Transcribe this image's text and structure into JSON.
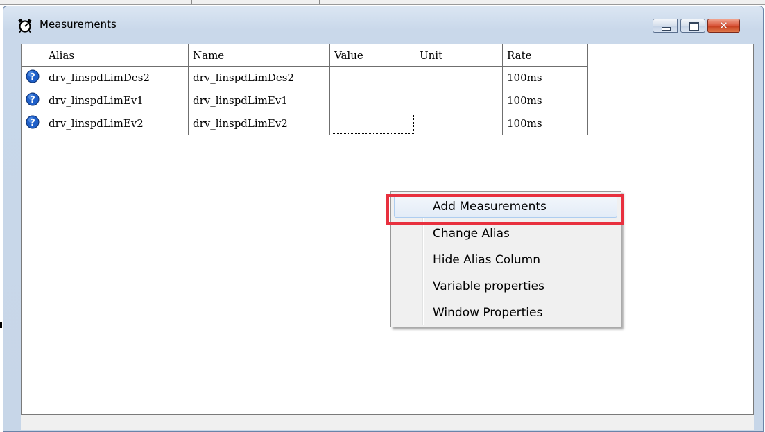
{
  "window": {
    "title": "Measurements",
    "controls": {
      "close_glyph": "✕"
    }
  },
  "table": {
    "columns": [
      "Alias",
      "Name",
      "Value",
      "Unit",
      "Rate"
    ],
    "rows": [
      {
        "icon": "help-icon",
        "alias": "drv_linspdLimDes2",
        "name": "drv_linspdLimDes2",
        "value": "",
        "unit": "",
        "rate": "100ms"
      },
      {
        "icon": "help-icon",
        "alias": "drv_linspdLimEv1",
        "name": "drv_linspdLimEv1",
        "value": "",
        "unit": "",
        "rate": "100ms"
      },
      {
        "icon": "help-icon",
        "alias": "drv_linspdLimEv2",
        "name": "drv_linspdLimEv2",
        "value": "",
        "unit": "",
        "rate": "100ms"
      }
    ]
  },
  "context_menu": {
    "items": [
      "Add Measurements",
      "Change Alias",
      "Hide Alias Column",
      "Variable properties",
      "Window Properties"
    ],
    "highlighted": "Add Measurements"
  },
  "colors": {
    "highlight_border": "#e8303e",
    "help_icon": "#1f5fc8"
  }
}
